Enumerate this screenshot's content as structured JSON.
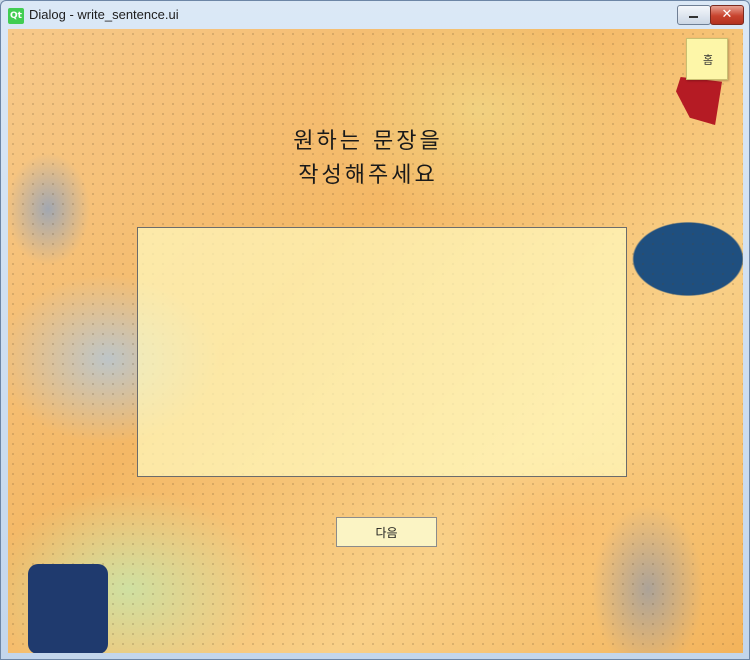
{
  "window": {
    "title": "Dialog - write_sentence.ui",
    "logo_text": "Qt",
    "close_glyph": "✕"
  },
  "dialog": {
    "corner_button_label": "홈",
    "title_line1": "원하는 문장을",
    "title_line2": "작성해주세요",
    "text_input_value": "",
    "next_button_label": "다음"
  },
  "colors": {
    "background_accent": "#f4b866",
    "input_fill": "#fffabe",
    "button_fill": "#fbf4c4",
    "corner_button_fill": "#fdf6a8"
  }
}
